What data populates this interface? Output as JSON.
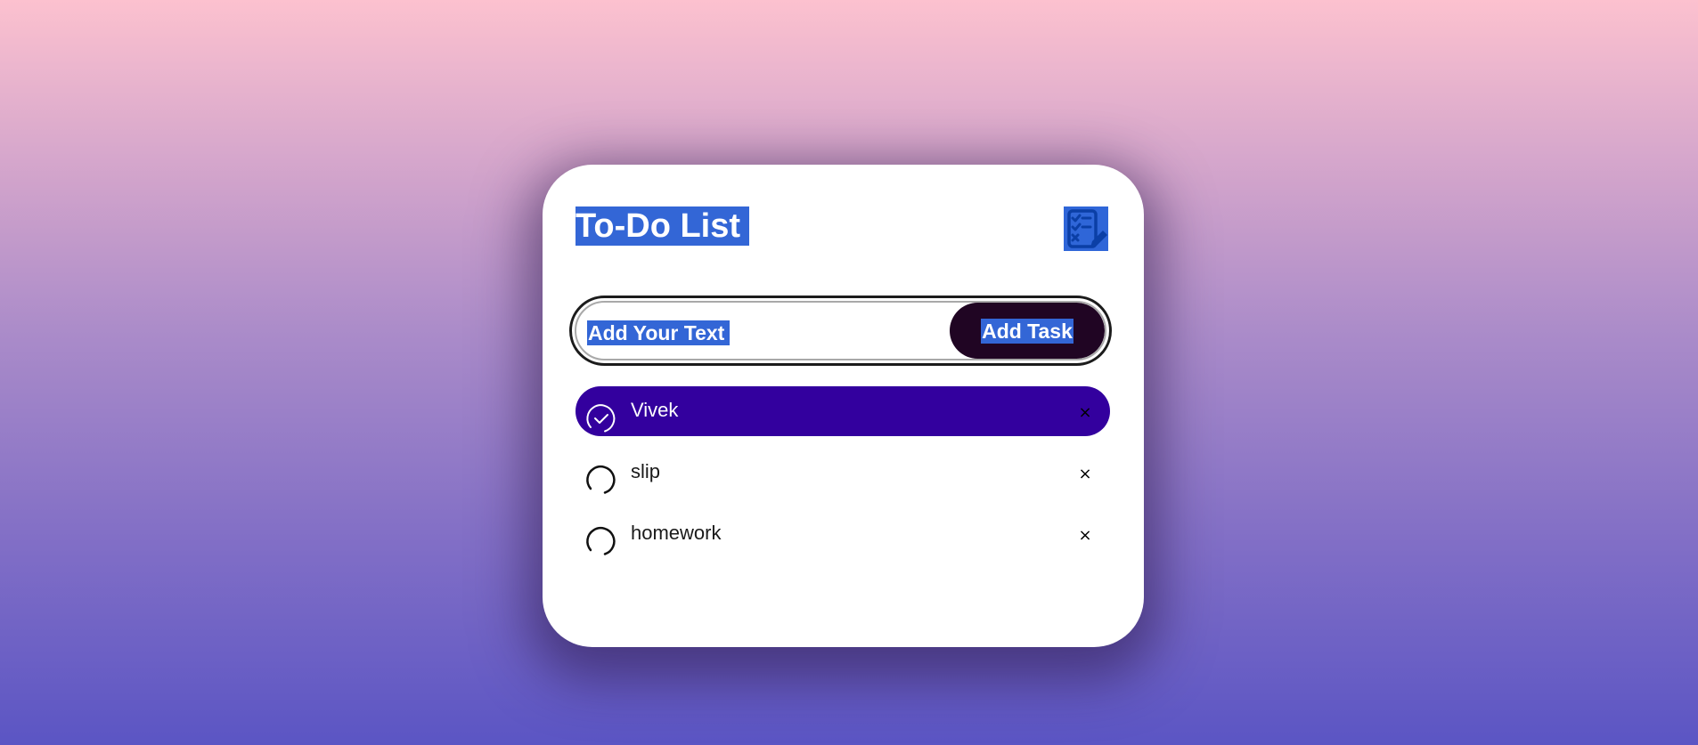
{
  "app": {
    "title": "To-Do List",
    "title_icon": "checklist-edit-icon"
  },
  "input": {
    "placeholder": "Add Your Text",
    "value": ""
  },
  "add_button": {
    "label": "Add Task"
  },
  "tasks": [
    {
      "text": "Vivek",
      "completed": true
    },
    {
      "text": "slip",
      "completed": false
    },
    {
      "text": "homework",
      "completed": false
    }
  ],
  "delete_icon": "×",
  "colors": {
    "background_top": "#fcc1cf",
    "background_bottom": "#5b55c4",
    "card": "#ffffff",
    "button": "#200523",
    "completed_task": "#33009e",
    "selection_highlight": "#3366d6"
  }
}
